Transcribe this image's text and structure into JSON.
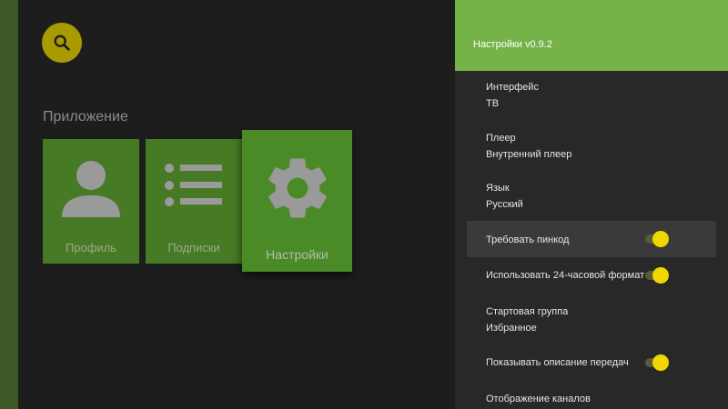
{
  "app": {
    "section_title": "Приложение",
    "cards": [
      {
        "label": "Профиль",
        "icon": "person-icon"
      },
      {
        "label": "Подписки",
        "icon": "list-icon"
      },
      {
        "label": "Настройки",
        "icon": "gear-icon"
      }
    ]
  },
  "settings_panel": {
    "title": "Настройки v0.9.2",
    "items": [
      {
        "label": "Интерфейс",
        "value": "ТВ"
      },
      {
        "label": "Плеер",
        "value": "Внутренний плеер"
      },
      {
        "label": "Язык",
        "value": "Русский"
      },
      {
        "label": "Требовать пинкод",
        "toggle": true
      },
      {
        "label": "Использовать 24-часовой формат",
        "toggle": true
      },
      {
        "label": "Стартовая группа",
        "value": "Избранное"
      },
      {
        "label": "Показывать описание передач",
        "toggle": true
      },
      {
        "label": "Отображение каналов"
      }
    ]
  },
  "colors": {
    "accent_green": "#76b24a",
    "card_green": "#477a25",
    "toggle_on": "#f1d600",
    "search_button": "#a89b00"
  }
}
